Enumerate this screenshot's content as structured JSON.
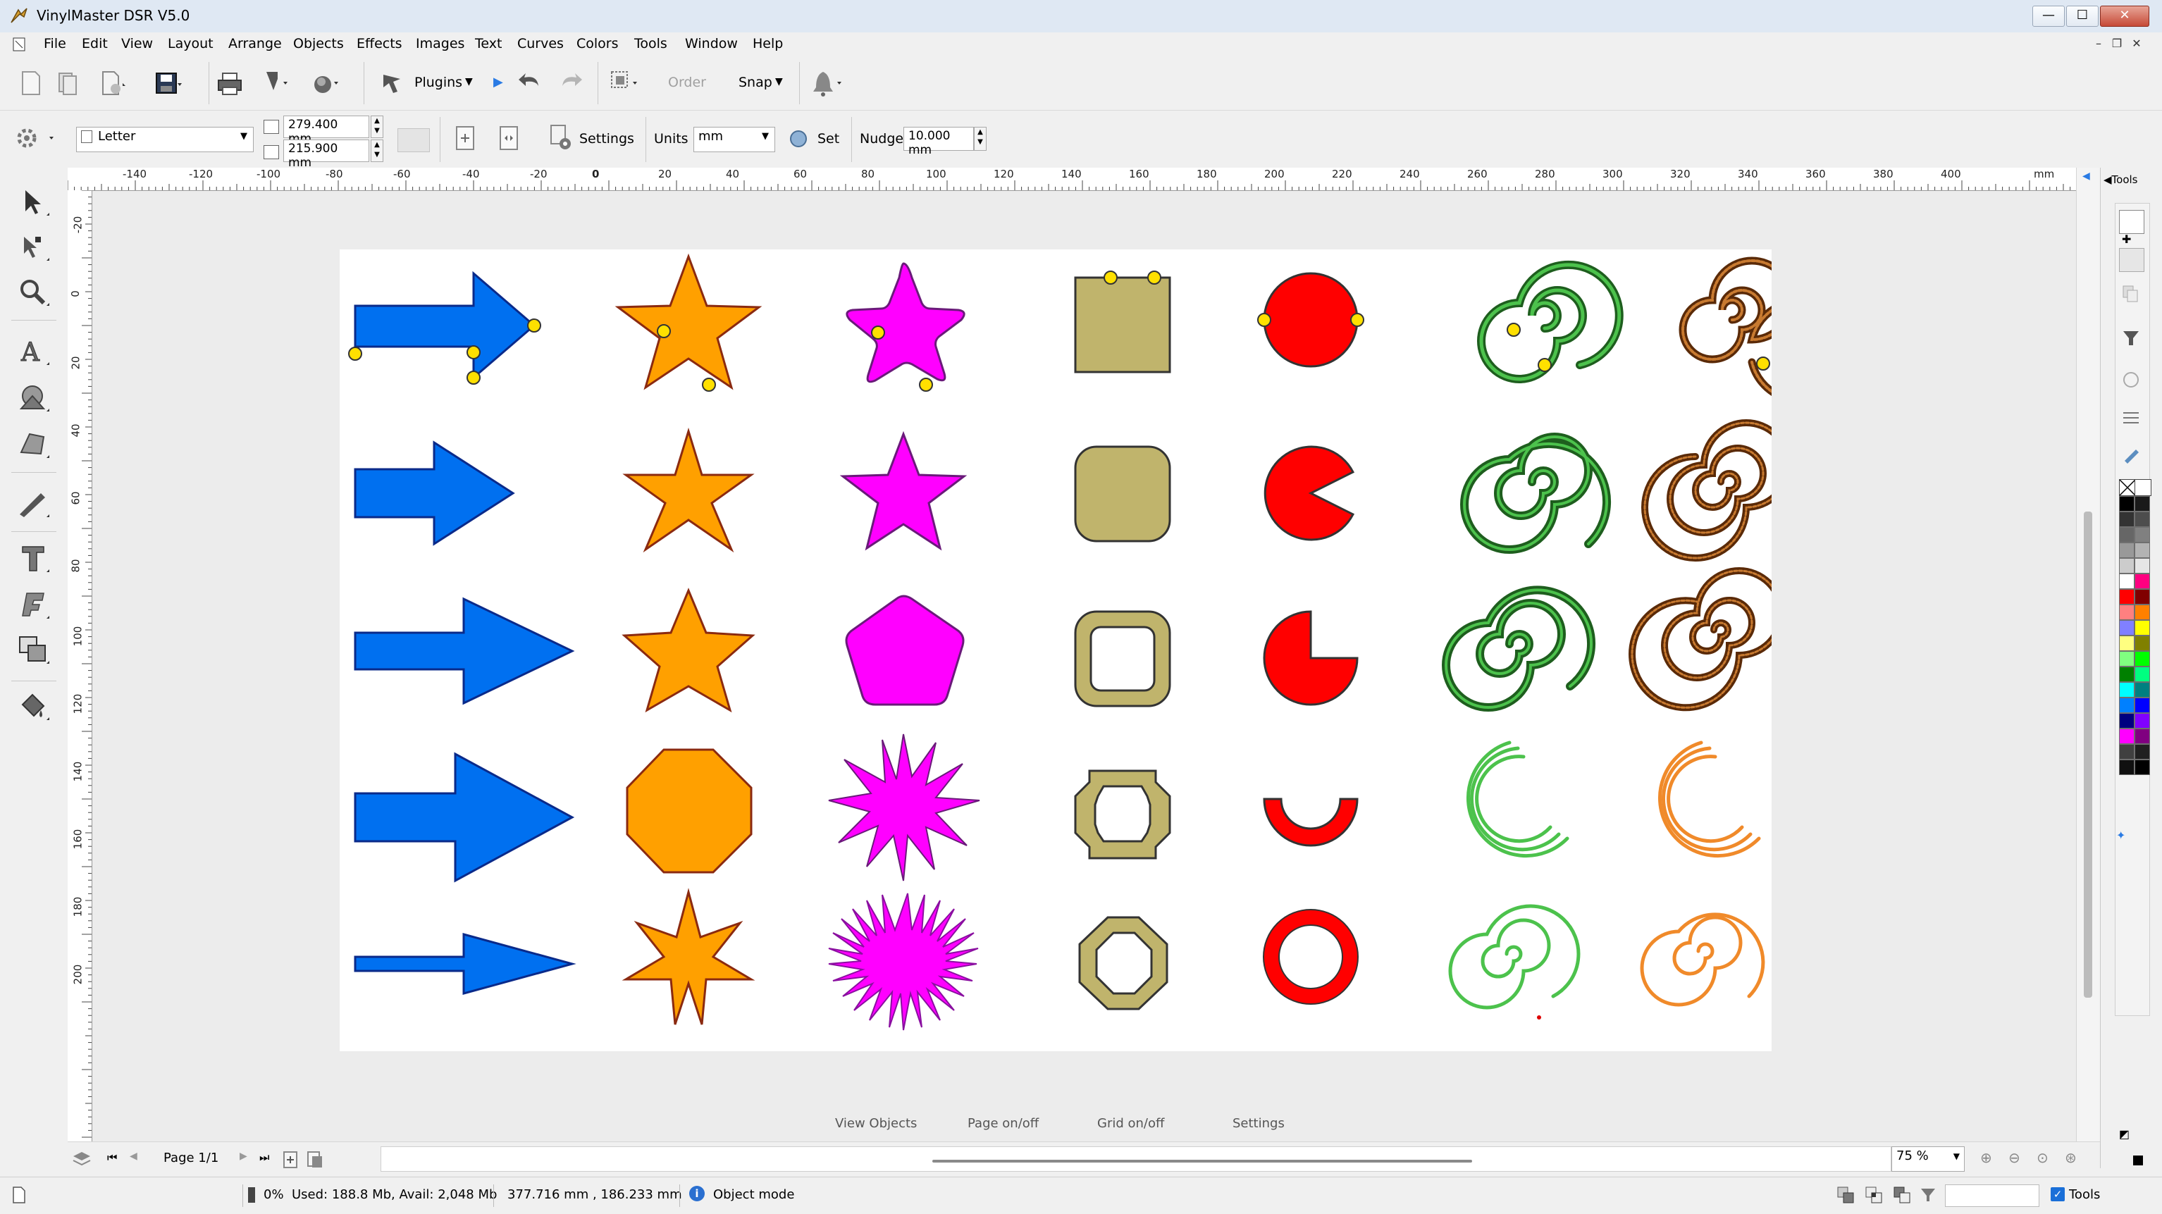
{
  "titlebar": {
    "title": "VinylMaster DSR V5.0",
    "min": "—",
    "max": "☐",
    "close": "✕"
  },
  "menubar": {
    "items": [
      "File",
      "Edit",
      "View",
      "Layout",
      "Arrange",
      "Objects",
      "Effects",
      "Images",
      "Text",
      "Curves",
      "Colors",
      "Tools",
      "Window",
      "Help"
    ],
    "mdi_min": "–",
    "mdi_restore": "❐",
    "mdi_close": "✕"
  },
  "toolbar1": {
    "plugins_label": "Plugins",
    "order_label": "Order",
    "snap_label": "Snap"
  },
  "toolbar2": {
    "page_size": "Letter",
    "width": "279.400 mm",
    "height": "215.900 mm",
    "settings_label": "Settings",
    "units_label": "Units",
    "units_value": "mm",
    "set_label": "Set",
    "nudge_label": "Nudge",
    "nudge_value": "10.000 mm"
  },
  "ruler": {
    "h_labels": [
      "-140",
      "-120",
      "-100",
      "-80",
      "-60",
      "-40",
      "-20",
      "0",
      "20",
      "40",
      "60",
      "80",
      "100",
      "120",
      "140",
      "160",
      "180",
      "200",
      "220",
      "240",
      "260",
      "280",
      "300",
      "320",
      "340",
      "360",
      "380",
      "400"
    ],
    "h_unit": "mm",
    "v_labels": [
      "-20",
      "0",
      "20",
      "40",
      "60",
      "80",
      "100",
      "120",
      "140",
      "160",
      "180",
      "200"
    ]
  },
  "right_dock": {
    "tab_label": "Tools",
    "palette": [
      "#000000",
      "#1a1a1a",
      "#333333",
      "#4d4d4d",
      "#666666",
      "#808080",
      "#999999",
      "#b3b3b3",
      "#cccccc",
      "#e6e6e6",
      "#ffffff",
      "#ff0080",
      "#ff0000",
      "#800000",
      "#ff8080",
      "#ff8000",
      "#8080ff",
      "#ffff00",
      "#ffff80",
      "#808000",
      "#80ff80",
      "#00ff00",
      "#008000",
      "#00ff80",
      "#00ffff",
      "#008080",
      "#0080ff",
      "#0000ff",
      "#000080",
      "#8000ff",
      "#ff00ff",
      "#800080",
      "#404040",
      "#202020",
      "#101010",
      "#000000"
    ]
  },
  "bottom_links": {
    "view_objects": "View Objects",
    "page_onoff": "Page on/off",
    "grid_onoff": "Grid on/off",
    "settings": "Settings"
  },
  "navbar": {
    "page_label": "Page 1/1",
    "zoom": "75 %"
  },
  "statusbar": {
    "progress": "0%",
    "memory": "Used: 188.8 Mb, Avail: 2,048 Mb",
    "coords": "377.716 mm , 186.233 mm",
    "mode": "Object mode",
    "tools_label": "Tools"
  },
  "colors": {
    "arrow": "#0070f0",
    "star_orange": "#ffa000",
    "star_magenta": "#ff00ff",
    "olive": "#c0b46c",
    "red": "#ff0000",
    "green": "#2f8a2f",
    "brown": "#8a4a1a",
    "light_green": "#4cc24c",
    "orange_spiral": "#f08a2a"
  }
}
